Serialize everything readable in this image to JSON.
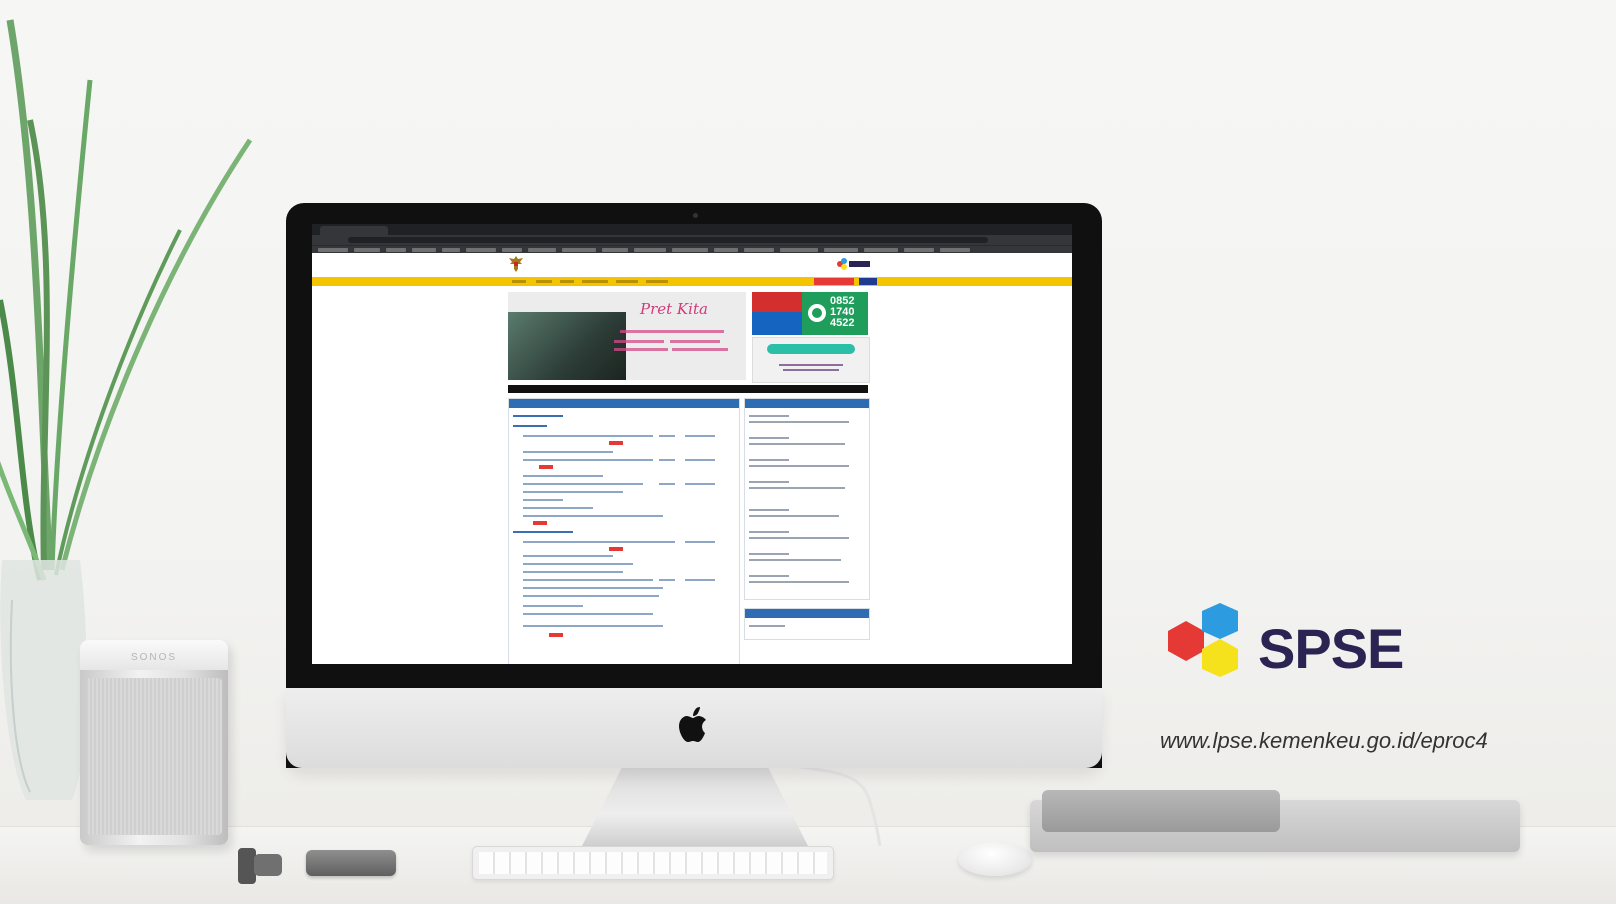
{
  "scene": {
    "caption_brand": "SPSE",
    "caption_url": "www.lpse.kemenkeu.go.id/eproc4",
    "speaker_brand": "SONOS"
  },
  "screen": {
    "banner_title": "Pret Kita",
    "whatsapp_number": "0852\n1740\n4522"
  },
  "colors": {
    "brand_dark": "#2b2453",
    "brand_red": "#e53935",
    "brand_blue": "#2d9be0",
    "brand_yellow": "#f5e11c",
    "site_yellow": "#f5c400",
    "site_blue": "#2e6db4"
  }
}
